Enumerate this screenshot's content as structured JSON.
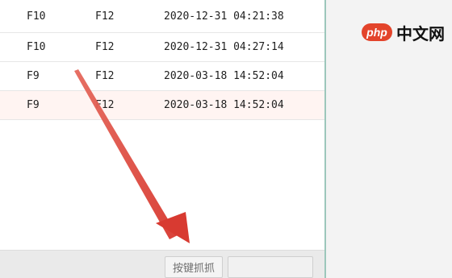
{
  "table": {
    "rows": [
      {
        "start_key": "F10",
        "end_key": "F12",
        "time": "2020-12-31 04:21:38"
      },
      {
        "start_key": "F10",
        "end_key": "F12",
        "time": "2020-12-31 04:27:14"
      },
      {
        "start_key": "F9",
        "end_key": "F12",
        "time": "2020-03-18 14:52:04"
      },
      {
        "start_key": "F9",
        "end_key": "F12",
        "time": "2020-03-18 14:52:04"
      }
    ]
  },
  "footer": {
    "capture_button_label": "按键抓抓"
  },
  "watermark": {
    "php_label": "php",
    "site_label": "中文网"
  },
  "colors": {
    "highlight_row": "#fff4f2",
    "annotation_arrow": "#e0483d",
    "watermark_red": "#e3442b"
  },
  "icons": {
    "annotation_arrow": "red-pointing-arrow"
  }
}
